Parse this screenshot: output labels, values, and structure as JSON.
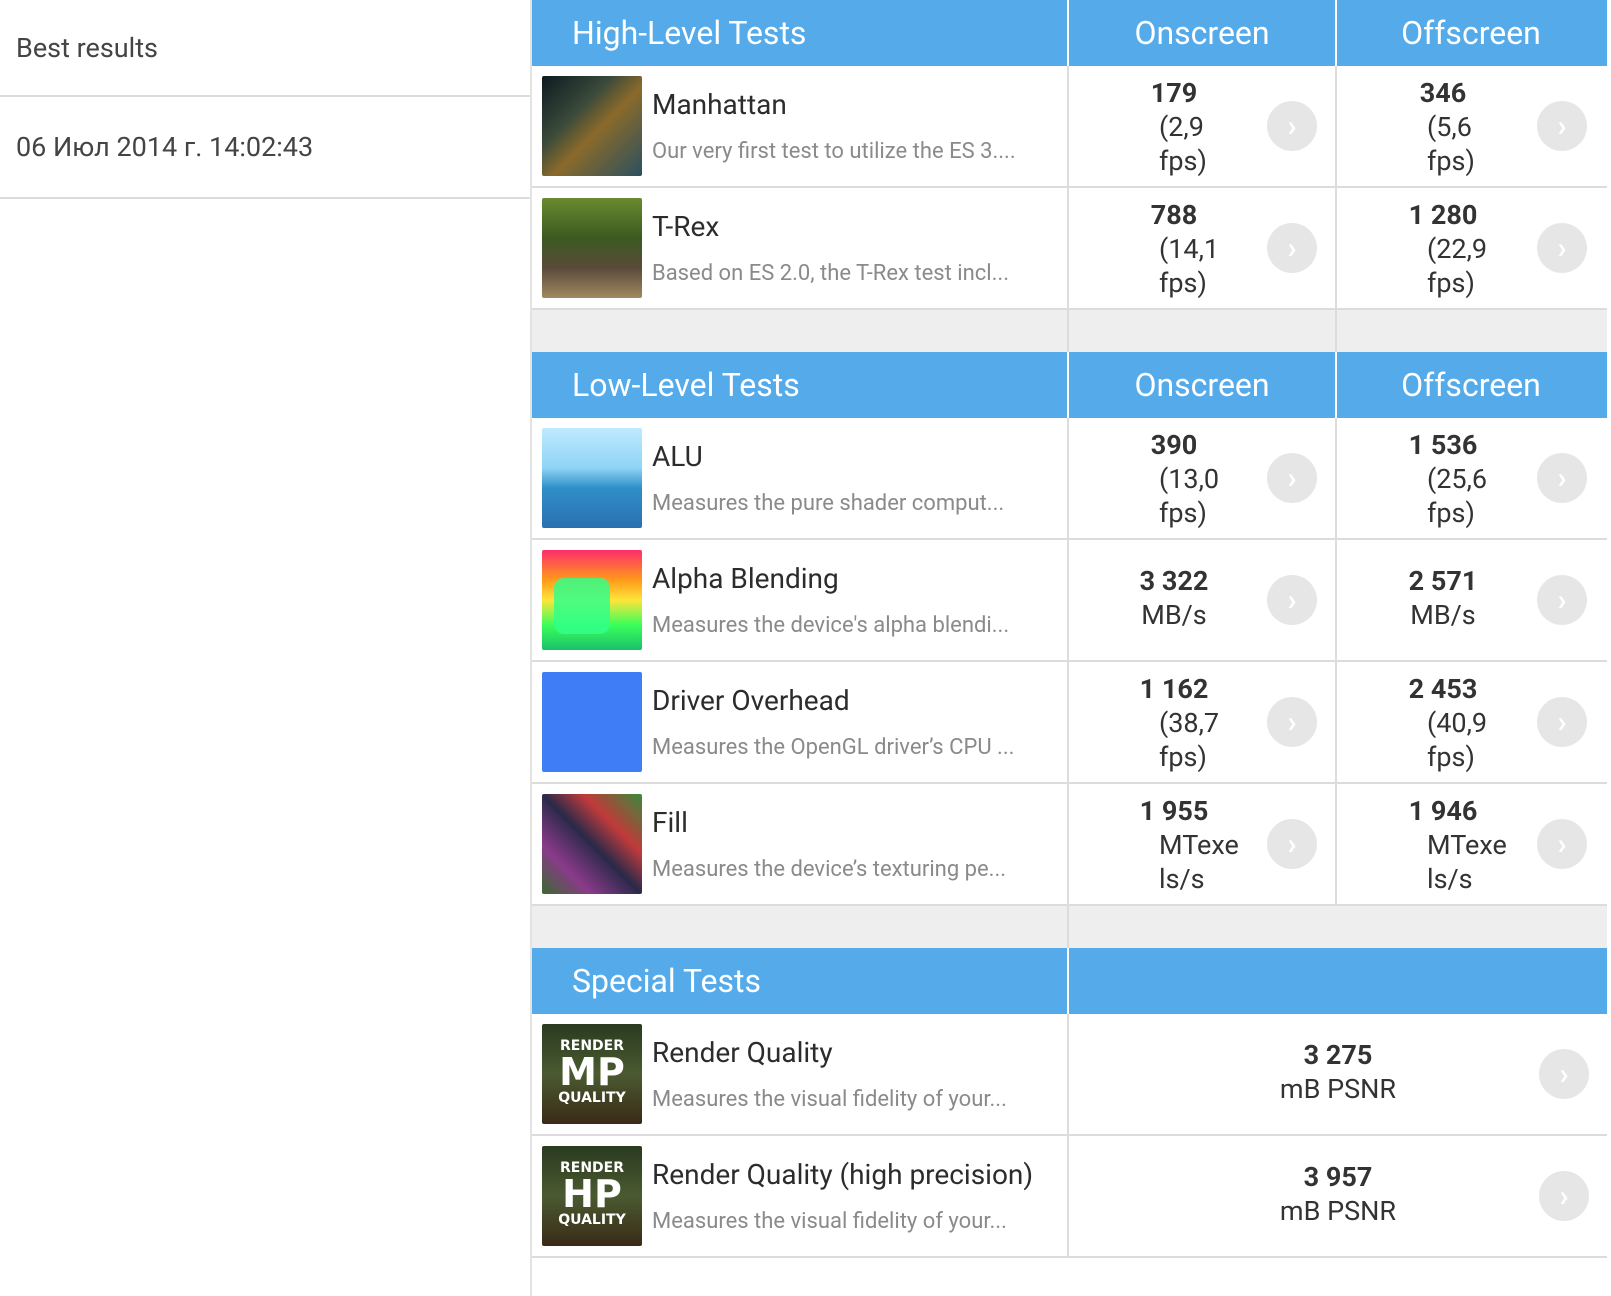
{
  "left": {
    "title": "Best results",
    "date": "06 Июл 2014 г. 14:02:43"
  },
  "high": {
    "header": "High-Level Tests",
    "onscreen": "Onscreen",
    "offscreen": "Offscreen",
    "rows": [
      {
        "name": "Manhattan",
        "desc": "Our very first test to utilize the ES 3....",
        "on_val": "179",
        "on_unit1": "(2,9",
        "on_unit2": "fps)",
        "off_val": "346",
        "off_unit1": "(5,6",
        "off_unit2": "fps)"
      },
      {
        "name": "T-Rex",
        "desc": "Based on ES 2.0, the T-Rex test incl...",
        "on_val": "788",
        "on_unit1": "(14,1",
        "on_unit2": "fps)",
        "off_val": "1 280",
        "off_unit1": "(22,9",
        "off_unit2": "fps)"
      }
    ]
  },
  "low": {
    "header": "Low-Level Tests",
    "onscreen": "Onscreen",
    "offscreen": "Offscreen",
    "rows": [
      {
        "name": "ALU",
        "desc": "Measures the pure shader comput...",
        "on_val": "390",
        "on_unit1": "(13,0",
        "on_unit2": "fps)",
        "off_val": "1 536",
        "off_unit1": "(25,6",
        "off_unit2": "fps)"
      },
      {
        "name": "Alpha Blending",
        "desc": "Measures the device's alpha blendi...",
        "on_val": "3 322",
        "on_unit1": "MB/s",
        "on_unit2": "",
        "off_val": "2 571",
        "off_unit1": "MB/s",
        "off_unit2": ""
      },
      {
        "name": "Driver Overhead",
        "desc": "Measures the OpenGL driver’s CPU ...",
        "on_val": "1 162",
        "on_unit1": "(38,7",
        "on_unit2": "fps)",
        "off_val": "2 453",
        "off_unit1": "(40,9",
        "off_unit2": "fps)"
      },
      {
        "name": "Fill",
        "desc": "Measures the device’s texturing pe...",
        "on_val": "1 955",
        "on_unit1": "MTexe",
        "on_unit2": "ls/s",
        "off_val": "1 946",
        "off_unit1": "MTexe",
        "off_unit2": "ls/s"
      }
    ]
  },
  "special": {
    "header": "Special Tests",
    "rows": [
      {
        "name": "Render Quality",
        "desc": "Measures the visual fidelity of your...",
        "val": "3 275",
        "unit": "mB PSNR",
        "badge_top": "RENDER",
        "badge_mid": "MP",
        "badge_bot": "QUALITY"
      },
      {
        "name": "Render Quality (high precision)",
        "desc": "Measures the visual fidelity of your...",
        "val": "3 957",
        "unit": "mB PSNR",
        "badge_top": "RENDER",
        "badge_mid": "HP",
        "badge_bot": "QUALITY"
      }
    ]
  },
  "icons": {
    "arrow": "chevron-right-icon"
  }
}
